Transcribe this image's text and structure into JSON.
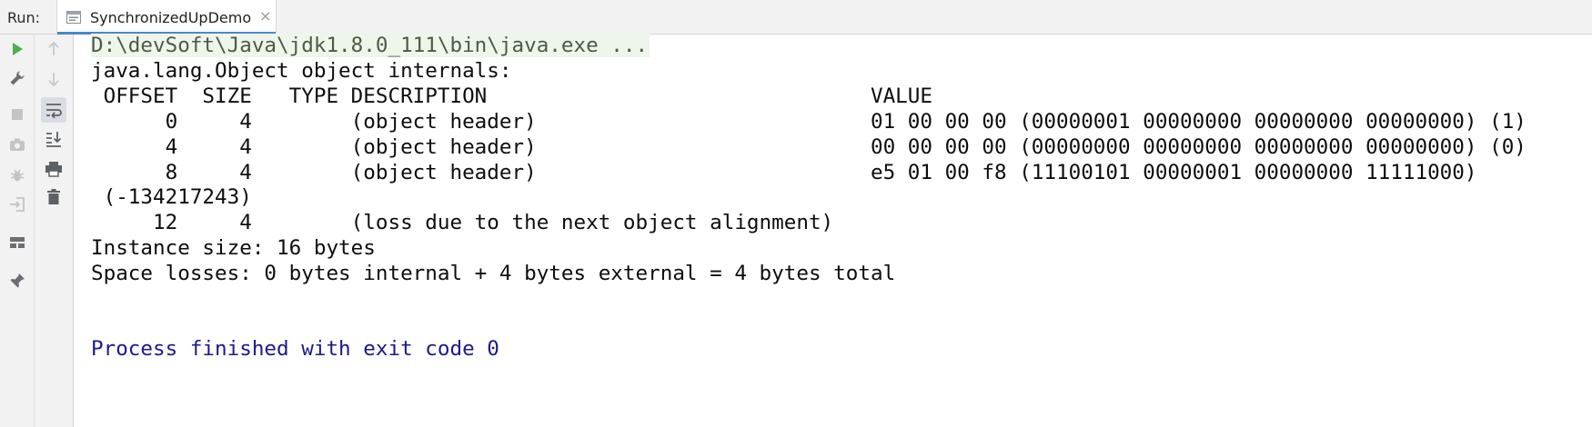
{
  "topbar": {
    "run_label": "Run:",
    "tab": {
      "title": "SynchronizedUpDemo",
      "close": "×",
      "icon": "run-config-icon"
    }
  },
  "toolbar_left": [
    "rerun-icon",
    "wrench-icon",
    "stop-icon",
    "camera-icon",
    "debug-icon",
    "login-icon",
    "layout-icon",
    "pin-icon"
  ],
  "toolbar_right": [
    "up-arrow-icon",
    "down-arrow-icon",
    "soft-wrap-icon",
    "scroll-to-end-icon",
    "print-icon",
    "trash-icon"
  ],
  "console": {
    "lines": [
      "D:\\devSoft\\Java\\jdk1.8.0_111\\bin\\java.exe ...",
      "java.lang.Object object internals:",
      " OFFSET  SIZE   TYPE DESCRIPTION                               VALUE",
      "      0     4        (object header)                           01 00 00 00 (00000001 00000000 00000000 00000000) (1)",
      "      4     4        (object header)                           00 00 00 00 (00000000 00000000 00000000 00000000) (0)",
      "      8     4        (object header)                           e5 01 00 f8 (11100101 00000001 00000000 11111000)",
      " (-134217243)",
      "     12     4        (loss due to the next object alignment)",
      "Instance size: 16 bytes",
      "Space losses: 0 bytes internal + 4 bytes external = 4 bytes total",
      "",
      "",
      "Process finished with exit code 0"
    ]
  },
  "colors": {
    "command_text": "#4e5a43",
    "command_bg": "#eef6ec",
    "exit_text": "#1a1a8c",
    "run_green": "#4caf50"
  }
}
